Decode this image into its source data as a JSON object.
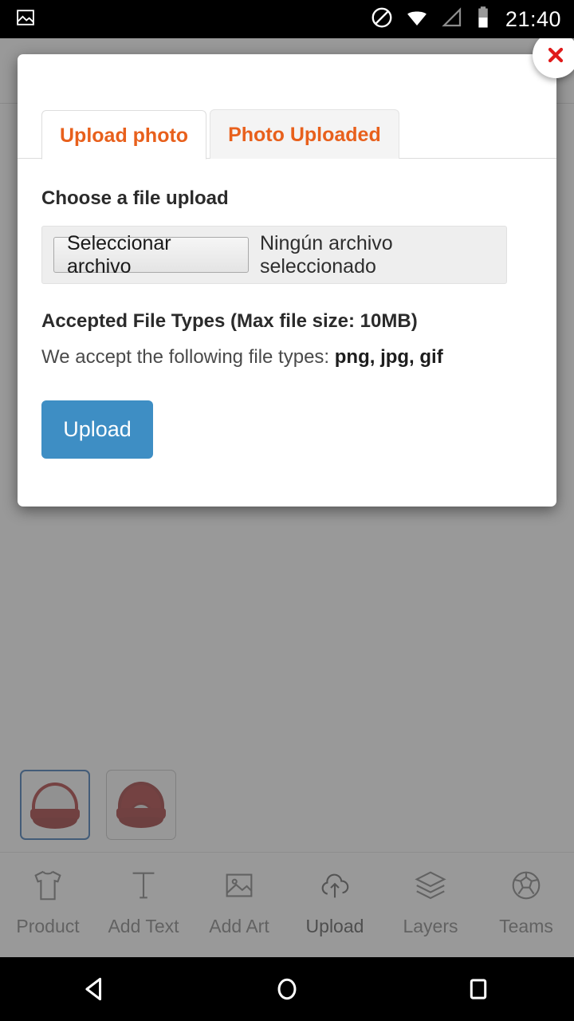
{
  "status_bar": {
    "clock": "21:40",
    "icons": [
      "photo-icon",
      "do-not-disturb-icon",
      "wifi-icon",
      "signal-icon",
      "battery-icon"
    ]
  },
  "modal": {
    "close_label": "✕",
    "tabs": [
      {
        "label": "Upload photo",
        "active": true
      },
      {
        "label": "Photo Uploaded",
        "active": false
      }
    ],
    "choose_file_heading": "Choose a file upload",
    "file_input": {
      "button_label": "Seleccionar archivo",
      "status_text": "Ningún archivo seleccionado"
    },
    "accepted_heading": "Accepted File Types (Max file size: 10MB)",
    "accepted_prefix": "We accept the following file types: ",
    "accepted_types": "png, jpg, gif",
    "upload_button_label": "Upload",
    "accent_color": "#e8601c",
    "upload_button_color": "#3e8ec4"
  },
  "thumbnails": [
    {
      "name": "cap-front-view",
      "selected": true
    },
    {
      "name": "cap-back-view",
      "selected": false
    }
  ],
  "toolbar": {
    "items": [
      {
        "label": "Product",
        "icon": "tshirt-icon",
        "active": false
      },
      {
        "label": "Add Text",
        "icon": "text-icon",
        "active": false
      },
      {
        "label": "Add Art",
        "icon": "image-icon",
        "active": false
      },
      {
        "label": "Upload",
        "icon": "cloud-upload-icon",
        "active": true
      },
      {
        "label": "Layers",
        "icon": "layers-icon",
        "active": false
      },
      {
        "label": "Teams",
        "icon": "soccer-ball-icon",
        "active": false
      }
    ]
  },
  "nav_bar": {
    "buttons": [
      {
        "name": "back-button",
        "icon": "triangle-back-icon"
      },
      {
        "name": "home-button",
        "icon": "circle-home-icon"
      },
      {
        "name": "recents-button",
        "icon": "square-recents-icon"
      }
    ]
  }
}
